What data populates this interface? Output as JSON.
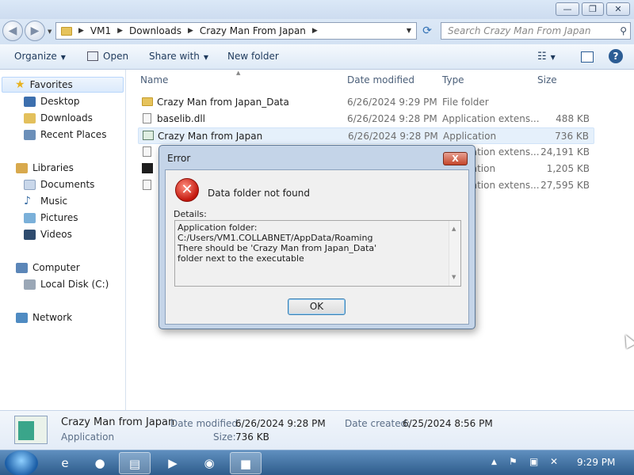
{
  "window": {
    "minimize": "—",
    "maximize": "❐",
    "close": "✕"
  },
  "address": {
    "back_icon": "back-arrow-icon",
    "forward_icon": "forward-arrow-icon",
    "crumbs": [
      "VM1",
      "Downloads",
      "Crazy Man From Japan"
    ],
    "search_placeholder": "Search Crazy Man From Japan"
  },
  "toolbar": {
    "organize": "Organize",
    "open": "Open",
    "share_with": "Share with",
    "new_folder": "New folder"
  },
  "nav": {
    "favorites": "Favorites",
    "desktop": "Desktop",
    "downloads": "Downloads",
    "recent_places": "Recent Places",
    "libraries": "Libraries",
    "documents": "Documents",
    "music": "Music",
    "pictures": "Pictures",
    "videos": "Videos",
    "computer": "Computer",
    "local_disk": "Local Disk (C:)",
    "network": "Network"
  },
  "columns": {
    "name": "Name",
    "date_modified": "Date modified",
    "type": "Type",
    "size": "Size"
  },
  "files": [
    {
      "name": "Crazy Man from Japan_Data",
      "date": "6/26/2024 9:29 PM",
      "type": "File folder",
      "size": ""
    },
    {
      "name": "baselib.dll",
      "date": "6/26/2024 9:28 PM",
      "type": "Application extens...",
      "size": "488 KB"
    },
    {
      "name": "Crazy Man from Japan",
      "date": "6/26/2024 9:28 PM",
      "type": "Application",
      "size": "736 KB"
    },
    {
      "name": "",
      "date": "",
      "type": "Application extens...",
      "size": "24,191 KB"
    },
    {
      "name": "",
      "date": "",
      "type": "Application",
      "size": "1,205 KB"
    },
    {
      "name": "",
      "date": "",
      "type": "Application extens...",
      "size": "27,595 KB"
    }
  ],
  "details": {
    "name": "Crazy Man from Japan",
    "kind": "Application",
    "date_modified_label": "Date modified:",
    "date_modified": "6/26/2024 9:28 PM",
    "date_created_label": "Date created:",
    "date_created": "6/25/2024 8:56 PM",
    "size_label": "Size:",
    "size": "736 KB"
  },
  "dialog": {
    "title": "Error",
    "close": "X",
    "message": "Data folder not found",
    "details_label": "Details:",
    "details_lines": [
      "Application folder:",
      "C:/Users/VM1.COLLABNET/AppData/Roaming",
      "There should be 'Crazy Man from Japan_Data'",
      "folder next to the executable"
    ],
    "ok": "OK"
  },
  "taskbar": {
    "clock": "9:29 PM"
  }
}
